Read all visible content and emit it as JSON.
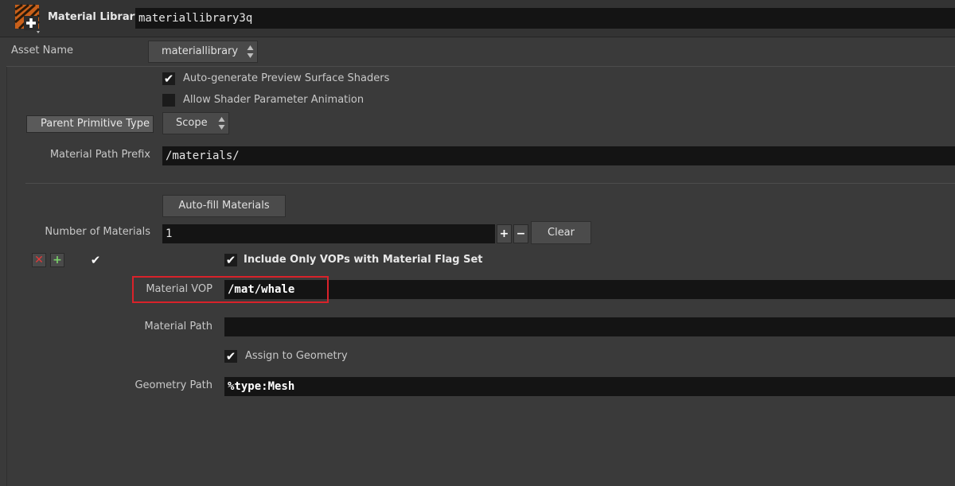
{
  "header": {
    "node_type": "Material Library",
    "node_name": "materiallibrary3q"
  },
  "asset": {
    "label": "Asset Name",
    "value": "materiallibrary"
  },
  "options": {
    "auto_preview_label": "Auto-generate Preview Surface Shaders",
    "auto_preview_checked": true,
    "allow_anim_label": "Allow Shader Parameter Animation",
    "allow_anim_checked": false
  },
  "parent_prim": {
    "label": "Parent Primitive Type",
    "value": "Scope"
  },
  "material_path_prefix": {
    "label": "Material Path Prefix",
    "value": "/materials/"
  },
  "autofill": {
    "label": "Auto-fill Materials"
  },
  "num_materials": {
    "label": "Number of Materials",
    "value": "1",
    "plus": "+",
    "minus": "−",
    "clear_label": "Clear"
  },
  "instance": {
    "remove_icon": "✕",
    "insert_icon": "+",
    "enabled_checked": true,
    "include_only_label": "Include Only VOPs with Material Flag Set",
    "include_only_checked": true,
    "material_vop_label": "Material VOP",
    "material_vop_value": "/mat/whale",
    "material_path_label": "Material Path",
    "material_path_value": "",
    "assign_label": "Assign to Geometry",
    "assign_checked": true,
    "geometry_path_label": "Geometry Path",
    "geometry_path_value": "%type:Mesh"
  },
  "colors": {
    "highlight": "#d9222a"
  }
}
